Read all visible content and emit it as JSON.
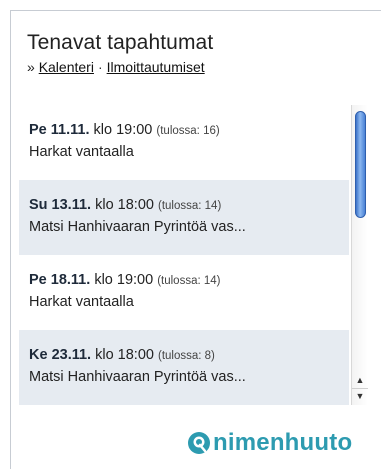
{
  "header": {
    "title": "Tenavat tapahtumat",
    "prefix": "»",
    "link_calendar": "Kalenteri",
    "separator": "·",
    "link_signups": "Ilmoittautumiset"
  },
  "events": [
    {
      "day": "Pe 11.11.",
      "time": "klo 19:00",
      "count": "(tulossa: 16)",
      "name": "Harkat vantaalla"
    },
    {
      "day": "Su 13.11.",
      "time": "klo 18:00",
      "count": "(tulossa: 14)",
      "name": "Matsi Hanhivaaran Pyrintöä vas..."
    },
    {
      "day": "Pe 18.11.",
      "time": "klo 19:00",
      "count": "(tulossa: 14)",
      "name": "Harkat vantaalla"
    },
    {
      "day": "Ke 23.11.",
      "time": "klo 18:00",
      "count": "(tulossa: 8)",
      "name": "Matsi Hanhivaaran Pyrintöä vas..."
    }
  ],
  "scroll": {
    "up": "▲",
    "down": "▼"
  },
  "logo": {
    "text": "nimenhuuto",
    "color": "#2d9bb0"
  }
}
